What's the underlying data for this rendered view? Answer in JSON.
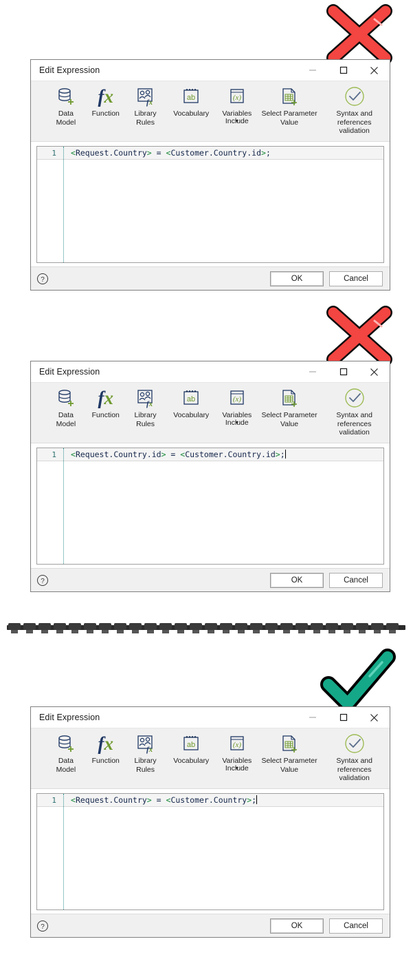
{
  "window": {
    "title": "Edit Expression",
    "controls": [
      {
        "name": "minimize",
        "glyph": "minimize-icon"
      },
      {
        "name": "maximize",
        "glyph": "maximize-icon"
      },
      {
        "name": "close",
        "glyph": "close-icon"
      }
    ]
  },
  "ribbon": {
    "items": [
      {
        "icon": "data-model-icon",
        "label": "Data\nModel",
        "sub": ""
      },
      {
        "icon": "function-fx-icon",
        "label": "Function",
        "sub": ""
      },
      {
        "icon": "library-rules-icon",
        "label": "Library\nRules",
        "sub": ""
      },
      {
        "icon": "vocabulary-ab-icon",
        "label": "Vocabulary",
        "sub": ""
      },
      {
        "icon": "variables-x-icon",
        "label": "Variables",
        "sub": "Include",
        "caret": "▼"
      },
      {
        "icon": "select-parameter-value-icon",
        "label": "Select Parameter\nValue",
        "sub": ""
      },
      {
        "icon": "validation-check-icon",
        "label": "Syntax and references\nvalidation",
        "sub": ""
      }
    ]
  },
  "footer": {
    "help": "?",
    "ok_label": "OK",
    "cancel_label": "Cancel"
  },
  "dialogs": [
    {
      "line_number": "1",
      "code": {
        "segments": [
          {
            "t": "<",
            "k": "ang"
          },
          {
            "t": "Request.Country",
            "k": "txt"
          },
          {
            "t": ">",
            "k": "ang"
          },
          {
            "t": " = ",
            "k": "txt"
          },
          {
            "t": "<",
            "k": "ang"
          },
          {
            "t": "Customer.Country.id",
            "k": "txt"
          },
          {
            "t": ">",
            "k": "ang"
          },
          {
            "t": ";",
            "k": "txt"
          }
        ]
      },
      "caret": false,
      "verdict": "wrong"
    },
    {
      "line_number": "1",
      "code": {
        "segments": [
          {
            "t": "<",
            "k": "ang"
          },
          {
            "t": "Request.Country.id",
            "k": "txt"
          },
          {
            "t": ">",
            "k": "ang"
          },
          {
            "t": " = ",
            "k": "txt"
          },
          {
            "t": "<",
            "k": "ang"
          },
          {
            "t": "Customer.Country.id",
            "k": "txt"
          },
          {
            "t": ">",
            "k": "ang"
          },
          {
            "t": ";",
            "k": "txt"
          }
        ]
      },
      "caret": true,
      "verdict": "wrong"
    },
    {
      "line_number": "1",
      "code": {
        "segments": [
          {
            "t": "<",
            "k": "ang"
          },
          {
            "t": "Request.Country",
            "k": "txt"
          },
          {
            "t": ">",
            "k": "ang"
          },
          {
            "t": " = ",
            "k": "txt"
          },
          {
            "t": "<",
            "k": "ang"
          },
          {
            "t": "Customer.Country",
            "k": "txt"
          },
          {
            "t": ">",
            "k": "ang"
          },
          {
            "t": ";",
            "k": "txt"
          }
        ]
      },
      "caret": true,
      "verdict": "correct"
    }
  ],
  "annotations": {
    "cross_color": "#f34541",
    "check_color": "#15a888",
    "divider": "spiral-binding-divider"
  },
  "colors": {
    "ribbon_bg": "#f0f0f0",
    "icon_dark": "#1f3864",
    "icon_green": "#6f9a2f",
    "code_blue": "#14264a",
    "code_green": "#1a8a3a",
    "gutter_teal": "#2f6f6f"
  }
}
